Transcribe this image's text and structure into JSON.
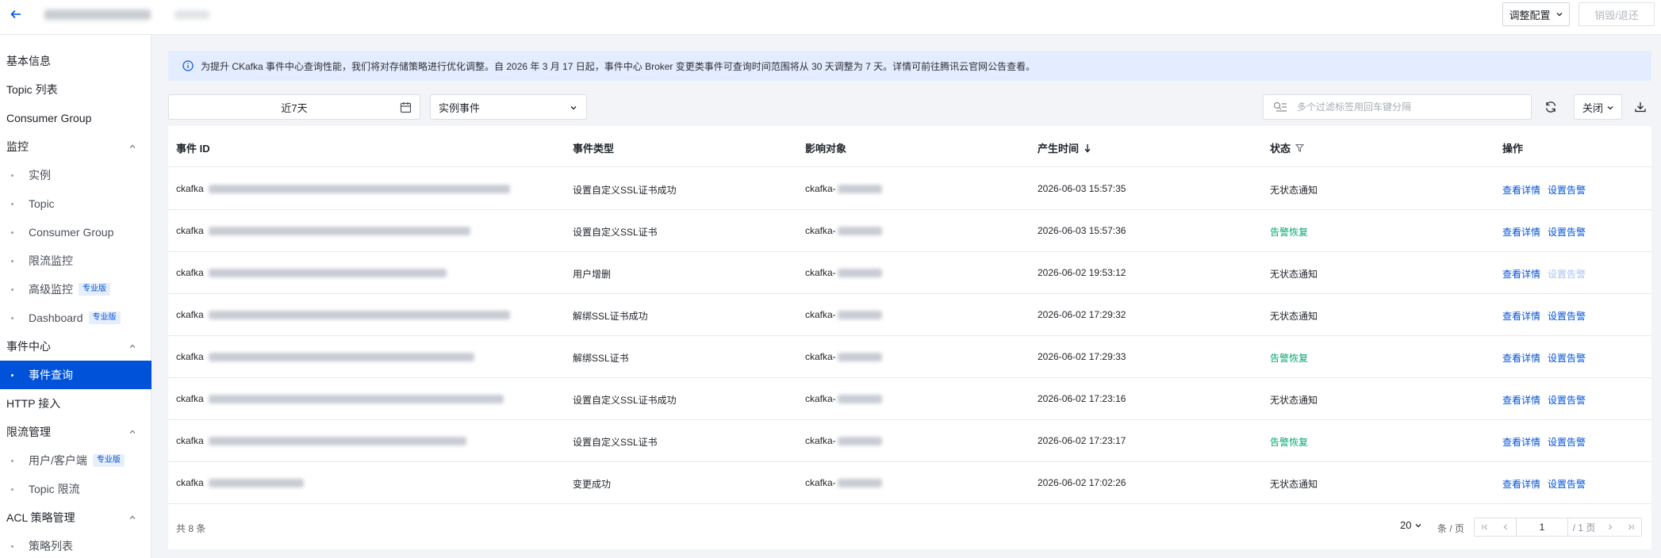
{
  "header": {
    "adjust_label": "调整配置",
    "destroy_label": "销毁/退还"
  },
  "sidebar": {
    "basic_info": "基本信息",
    "topic_list": "Topic 列表",
    "consumer_group": "Consumer Group",
    "monitor": {
      "label": "监控",
      "items": [
        "实例",
        "Topic",
        "Consumer Group",
        "限流监控",
        "高级监控",
        "Dashboard"
      ],
      "pro_tag": "专业版"
    },
    "event_center": {
      "label": "事件中心",
      "items": [
        "事件查询"
      ]
    },
    "http_access": "HTTP 接入",
    "rate_limit": {
      "label": "限流管理",
      "items": [
        "用户/客户端",
        "Topic 限流"
      ]
    },
    "acl": {
      "label": "ACL 策略管理",
      "items": [
        "策略列表"
      ]
    }
  },
  "notice": {
    "text": "为提升 CKafka 事件中心查询性能，我们将对存储策略进行优化调整。自 2026 年 3 月 17 日起，事件中心 Broker 变更类事件可查询时间范围将从 30 天调整为 7 天。详情可前往腾讯云官网公告查看。"
  },
  "filters": {
    "date_range": "近7天",
    "event_type": "实例事件",
    "search_placeholder": "多个过滤标签用回车键分隔",
    "close_label": "关闭"
  },
  "table": {
    "columns": {
      "id": "事件 ID",
      "type": "事件类型",
      "target": "影响对象",
      "time": "产生时间",
      "status": "状态",
      "ops": "操作"
    },
    "id_prefix": "ckafka",
    "target_prefix": "ckafka-",
    "op_detail": "查看详情",
    "op_alarm": "设置告警",
    "rows": [
      {
        "type": "设置自定义SSL证书成功",
        "time": "2026-06-03 15:57:35",
        "status": "无状态通知",
        "status_color": "#1f2329"
      },
      {
        "type": "设置自定义SSL证书",
        "time": "2026-06-03 15:57:36",
        "status": "告警恢复",
        "status_color": "#00a870"
      },
      {
        "type": "用户增删",
        "time": "2026-06-02 19:53:12",
        "status": "无状态通知",
        "status_color": "#1f2329"
      },
      {
        "type": "解绑SSL证书成功",
        "time": "2026-06-02 17:29:32",
        "status": "无状态通知",
        "status_color": "#1f2329"
      },
      {
        "type": "解绑SSL证书",
        "time": "2026-06-02 17:29:33",
        "status": "告警恢复",
        "status_color": "#00a870"
      },
      {
        "type": "设置自定义SSL证书成功",
        "time": "2026-06-02 17:23:16",
        "status": "无状态通知",
        "status_color": "#1f2329"
      },
      {
        "type": "设置自定义SSL证书",
        "time": "2026-06-02 17:23:17",
        "status": "告警恢复",
        "status_color": "#00a870"
      },
      {
        "type": "变更成功",
        "time": "2026-06-02 17:02:26",
        "status": "无状态通知",
        "status_color": "#1f2329"
      }
    ]
  },
  "footer": {
    "total": "共 8 条",
    "page_size": "20",
    "page_size_unit": "条 / 页",
    "current_page": "1",
    "page_total": "/ 1 页"
  },
  "colors": {
    "primary": "#0052d9",
    "success": "#00a870",
    "notice_bg": "#e4edff"
  }
}
